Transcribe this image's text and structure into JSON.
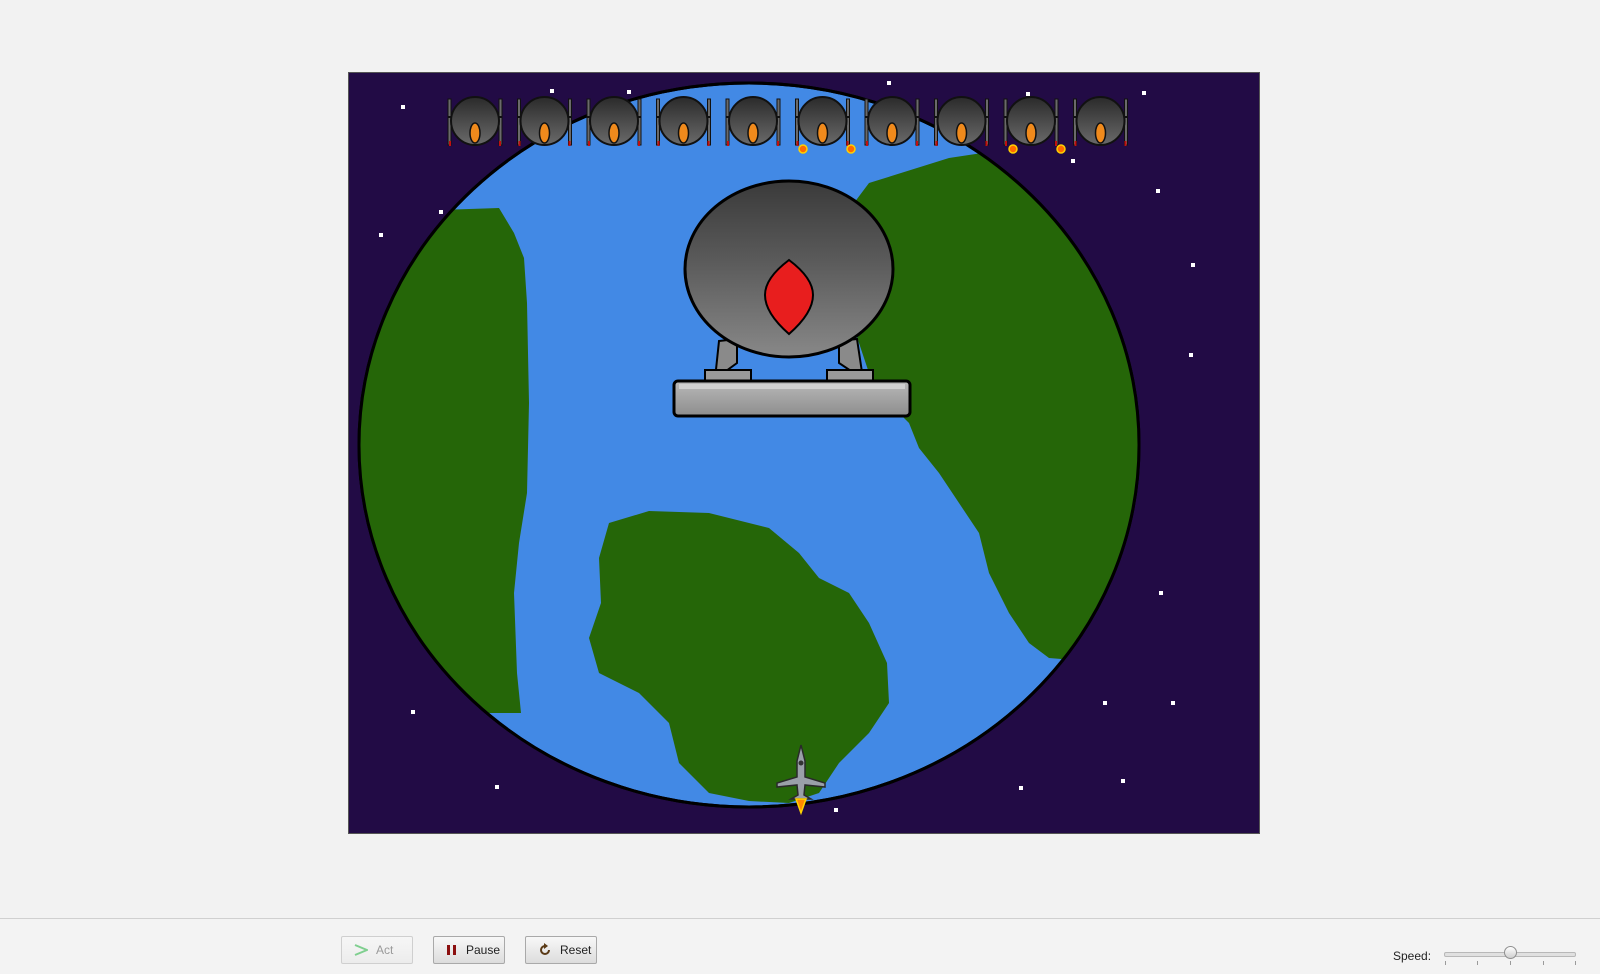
{
  "controls": {
    "act": {
      "label": "Act",
      "icon": "play-arrow-icon",
      "enabled": false
    },
    "pause": {
      "label": "Pause",
      "icon": "pause-icon",
      "enabled": true
    },
    "reset": {
      "label": "Reset",
      "icon": "reset-icon",
      "enabled": true
    },
    "speed": {
      "label": "Speed:",
      "value": 0.5
    }
  },
  "world": {
    "background_color": "#220b45",
    "ocean_color": "#4289e5",
    "land_color": "#256608",
    "enemy_count": 10,
    "boss_gem_color": "#e81e1e",
    "enemy_core_color": "#f08a1c"
  }
}
